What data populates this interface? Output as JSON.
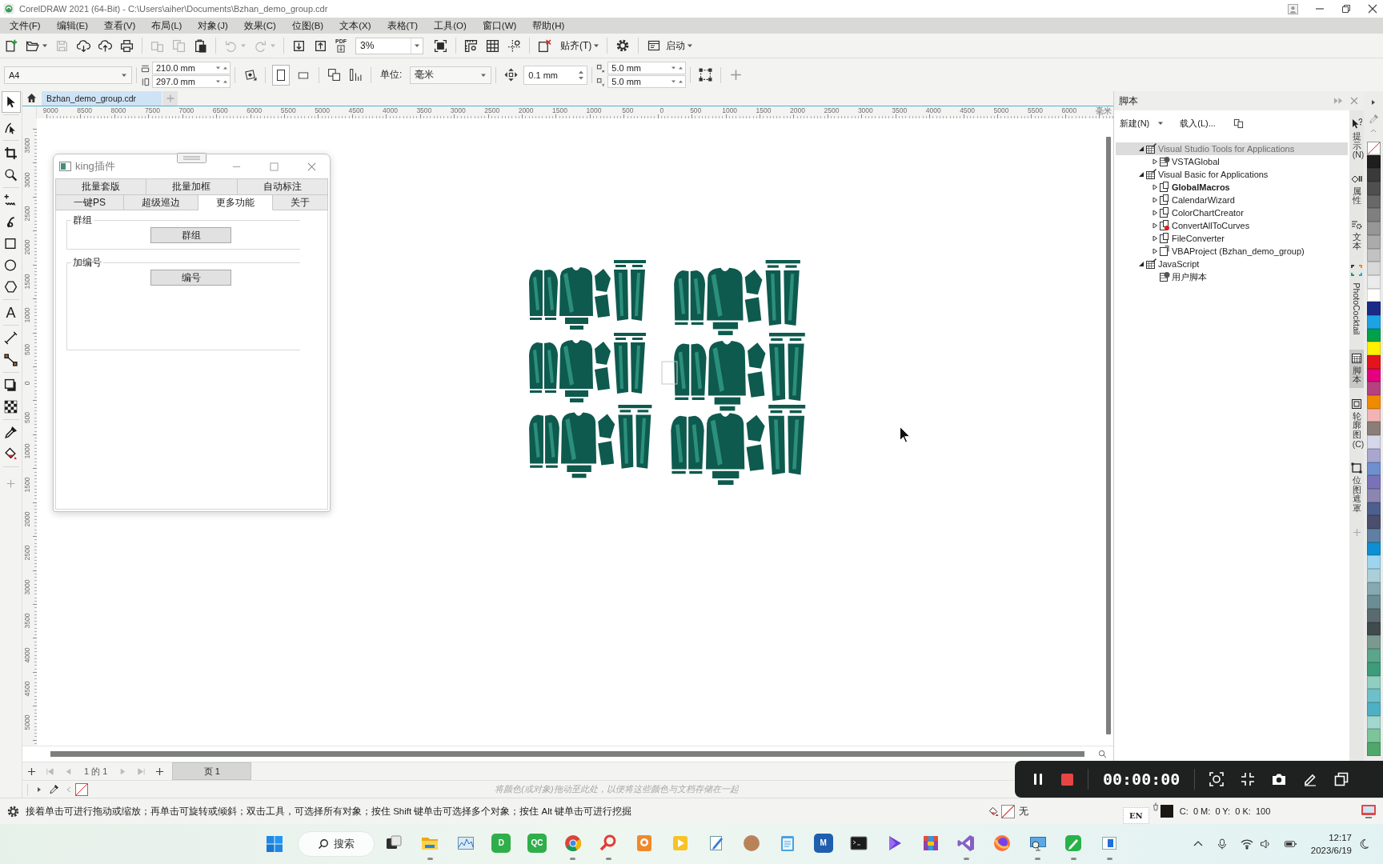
{
  "window": {
    "title": "CorelDRAW 2021 (64-Bit) - C:\\Users\\aiher\\Documents\\Bzhan_demo_group.cdr"
  },
  "menu": [
    "文件(F)",
    "编辑(E)",
    "查看(V)",
    "布局(L)",
    "对象(J)",
    "效果(C)",
    "位图(B)",
    "文本(X)",
    "表格(T)",
    "工具(O)",
    "窗口(W)",
    "帮助(H)"
  ],
  "toolbar": {
    "left_groups": [
      [
        {
          "kind": "new",
          "disabled": false
        },
        {
          "kind": "open",
          "disabled": false
        },
        {
          "kind": "save",
          "disabled": true
        },
        {
          "kind": "cloud-download",
          "disabled": false
        },
        {
          "kind": "cloud-upload",
          "disabled": false
        },
        {
          "kind": "print",
          "disabled": false
        }
      ],
      [
        {
          "kind": "cut",
          "disabled": true
        },
        {
          "kind": "copy",
          "disabled": true
        },
        {
          "kind": "paste",
          "disabled": false
        }
      ],
      [
        {
          "kind": "undo",
          "disabled": true
        },
        {
          "kind": "redo",
          "disabled": true
        }
      ],
      [
        {
          "kind": "import",
          "disabled": false
        },
        {
          "kind": "export",
          "disabled": false
        },
        {
          "kind": "pdf",
          "disabled": false,
          "label": "PDF"
        }
      ]
    ],
    "zoom": "3%",
    "right_groups": [
      [
        {
          "kind": "full-page",
          "disabled": false
        }
      ],
      [
        {
          "kind": "rulers",
          "disabled": false
        },
        {
          "kind": "grid",
          "disabled": false
        },
        {
          "kind": "guides",
          "disabled": false
        }
      ],
      [
        {
          "kind": "snap-off",
          "disabled": false
        }
      ]
    ],
    "snap_label": "贴齐(T)",
    "launch_label": "启动"
  },
  "property_bar": {
    "page_size": "A4",
    "page_width": "210.0 mm",
    "page_height": "297.0 mm",
    "orientations": [
      {
        "kind": "portrait",
        "selected": true
      },
      {
        "kind": "landscape",
        "selected": false
      }
    ],
    "units_label": "单位:",
    "units": "毫米",
    "nudge": "0.1 mm",
    "duplicate_x": "5.0 mm",
    "duplicate_y": "5.0 mm"
  },
  "document_tabs": [
    {
      "label": "Bzhan_demo_group.cdr",
      "selected": true
    }
  ],
  "toolbox": [
    [
      {
        "kind": "pick",
        "selected": true
      }
    ],
    [
      {
        "kind": "shape",
        "selected": false
      }
    ],
    [
      {
        "kind": "crop",
        "selected": false
      },
      {
        "kind": "zoom",
        "selected": false
      }
    ],
    [
      {
        "kind": "freehand",
        "selected": false
      },
      {
        "kind": "artistic-media",
        "selected": false
      },
      {
        "kind": "rectangle",
        "selected": false
      },
      {
        "kind": "ellipse",
        "selected": false
      },
      {
        "kind": "polygon",
        "selected": false
      }
    ],
    [
      {
        "kind": "text",
        "selected": false,
        "label": "A"
      }
    ],
    [
      {
        "kind": "dimension",
        "selected": false
      },
      {
        "kind": "connector",
        "selected": false
      }
    ],
    [
      {
        "kind": "shadow",
        "selected": false
      },
      {
        "kind": "transparency",
        "selected": false
      }
    ],
    [
      {
        "kind": "eyedropper",
        "selected": false
      },
      {
        "kind": "fill",
        "selected": false
      }
    ]
  ],
  "rulers": {
    "horizontal": [
      "9000",
      "8500",
      "8000",
      "7500",
      "7000",
      "6500",
      "6000",
      "5500",
      "5000",
      "4500",
      "4000",
      "3500",
      "3000",
      "2500",
      "2000",
      "1500",
      "1000",
      "500",
      "0",
      "500",
      "1000",
      "1500",
      "2000",
      "2500",
      "3000",
      "3500",
      "4000",
      "4500",
      "5000",
      "5500",
      "6000"
    ],
    "unit": "毫米",
    "vertical": [
      "3500",
      "3000",
      "2500",
      "2000",
      "1500",
      "1000",
      "500",
      "0",
      "500",
      "1000",
      "1500",
      "2000",
      "2500",
      "3000",
      "3500",
      "4000",
      "4500",
      "5000"
    ]
  },
  "plugin_dialog": {
    "title": "king插件",
    "tab_rows": [
      [
        {
          "label": "批量套版",
          "selected": false
        },
        {
          "label": "批量加框",
          "selected": false
        },
        {
          "label": "自动标注",
          "selected": false
        }
      ],
      [
        {
          "label": "一键PS",
          "selected": false
        },
        {
          "label": "超级巡边",
          "selected": false
        },
        {
          "label": "更多功能",
          "selected": true
        },
        {
          "label": "关于",
          "selected": false
        }
      ]
    ],
    "groups": [
      {
        "title": "群组",
        "button": "群组"
      },
      {
        "title": "加编号",
        "button": "编号"
      }
    ]
  },
  "docker": {
    "title": "脚本",
    "new_label": "新建(N)",
    "load_label": "载入(L)...",
    "tree": [
      {
        "label": "Visual Studio Tools for Applications",
        "kind": "root",
        "expanded": true,
        "selected": true,
        "disabled": true,
        "active": false,
        "children": [
          {
            "label": "VSTAGlobal",
            "kind": "global",
            "expanded": false,
            "selected": false,
            "disabled": false,
            "active": false
          }
        ]
      },
      {
        "label": "Visual Basic for Applications",
        "kind": "root",
        "expanded": true,
        "selected": false,
        "disabled": false,
        "active": false,
        "children": [
          {
            "label": "GlobalMacros",
            "kind": "project",
            "expanded": false,
            "selected": false,
            "disabled": false,
            "active": true
          },
          {
            "label": "CalendarWizard",
            "kind": "project",
            "expanded": false,
            "selected": false,
            "disabled": false,
            "active": false
          },
          {
            "label": "ColorChartCreator",
            "kind": "project",
            "expanded": false,
            "selected": false,
            "disabled": false,
            "active": false
          },
          {
            "label": "ConvertAllToCurves",
            "kind": "project-error",
            "expanded": false,
            "selected": false,
            "disabled": false,
            "active": false
          },
          {
            "label": "FileConverter",
            "kind": "project",
            "expanded": false,
            "selected": false,
            "disabled": false,
            "active": false
          },
          {
            "label": "VBAProject (Bzhan_demo_group)",
            "kind": "document",
            "expanded": false,
            "selected": false,
            "disabled": false,
            "active": false
          }
        ]
      },
      {
        "label": "JavaScript",
        "kind": "root",
        "expanded": true,
        "selected": false,
        "disabled": false,
        "active": false,
        "children": [
          {
            "label": "用户脚本",
            "kind": "global",
            "selected": false,
            "disabled": false,
            "active": false
          }
        ]
      }
    ]
  },
  "docker_tabs": [
    {
      "kind": "hints",
      "label": "提示(N)",
      "selected": false
    },
    {
      "kind": "properties",
      "label": "属性",
      "selected": false
    },
    {
      "kind": "text",
      "label": "文本",
      "selected": false
    },
    {
      "kind": "photococktail",
      "label": "PhotoCocktail",
      "selected": false
    },
    {
      "kind": "scripts",
      "label": "脚本",
      "selected": true
    },
    {
      "kind": "contour",
      "label": "轮廓图(C)",
      "selected": false
    },
    {
      "kind": "bitmap-mask",
      "label": "位图遮罩",
      "selected": false
    }
  ],
  "palette": [
    {
      "color": "#1e1e1e"
    },
    {
      "color": "#3a3a3a"
    },
    {
      "color": "#4f4f4f"
    },
    {
      "color": "#686868"
    },
    {
      "color": "#7f7f7f"
    },
    {
      "color": "#969696"
    },
    {
      "color": "#ababab"
    },
    {
      "color": "#c2c2c2"
    },
    {
      "color": "#d8d8d8"
    },
    {
      "color": "#ebebeb"
    },
    {
      "color": "#ffffff"
    },
    {
      "color": "#1b2a87"
    },
    {
      "color": "#1ba3e3"
    },
    {
      "color": "#00a14b"
    },
    {
      "color": "#fff200"
    },
    {
      "color": "#e3141b"
    },
    {
      "color": "#e4007f"
    },
    {
      "color": "#b5417f"
    },
    {
      "color": "#f08a00"
    },
    {
      "color": "#f2b3b3"
    },
    {
      "color": "#8b7d77"
    },
    {
      "color": "#d6d6ea"
    },
    {
      "color": "#a9a6d0"
    },
    {
      "color": "#6f8fcf"
    },
    {
      "color": "#7a72b8"
    },
    {
      "color": "#8b85b0"
    },
    {
      "color": "#4d5f8e"
    },
    {
      "color": "#4b4e6c"
    },
    {
      "color": "#5f7fa3"
    },
    {
      "color": "#0d8fd3"
    },
    {
      "color": "#9dd5ee"
    },
    {
      "color": "#a9cfd8"
    },
    {
      "color": "#86a9b1"
    },
    {
      "color": "#6b8d94"
    },
    {
      "color": "#5a6a6e"
    },
    {
      "color": "#3f4b4d"
    },
    {
      "color": "#7a9a90"
    },
    {
      "color": "#5aa58c"
    },
    {
      "color": "#3d9b7a"
    },
    {
      "color": "#8fcfc0"
    },
    {
      "color": "#6ec0c8"
    },
    {
      "color": "#4fb0c4"
    },
    {
      "color": "#a0d8cf"
    },
    {
      "color": "#7cc49a"
    },
    {
      "color": "#4ea86a"
    }
  ],
  "page_navigator": {
    "position": "1 的 1",
    "pages": [
      {
        "label": "页 1",
        "selected": true
      }
    ]
  },
  "document_palette": {
    "hint": "将颜色(或对象)拖动至此处，以便将这些颜色与文档存储在一起"
  },
  "status_bar": {
    "message": "接着单击可进行拖动或缩放；再单击可旋转或倾斜；双击工具，可选择所有对象；按住 Shift 键单击可选择多个对象；按住 Alt 键单击可进行挖掘",
    "fill_label": "无",
    "ime": "EN",
    "outline_values": "C:  0 M:  0 Y:  0 K:  100"
  },
  "recorder": {
    "elapsed": "00:00:00"
  },
  "taskbar": {
    "search": {
      "placeholder": "搜索"
    },
    "apps": [
      {
        "kind": "task-view",
        "running": false
      },
      {
        "kind": "explorer",
        "running": true
      },
      {
        "kind": "res-monitor",
        "running": false
      },
      {
        "kind": "tile",
        "label": "D",
        "running": false
      },
      {
        "kind": "tile",
        "label": "QC",
        "running": false
      },
      {
        "kind": "chrome",
        "running": true
      },
      {
        "kind": "search-app",
        "running": true
      },
      {
        "kind": "pdf-app",
        "running": false
      },
      {
        "kind": "video-app",
        "running": false
      },
      {
        "kind": "pen-note",
        "running": false
      },
      {
        "kind": "avatar",
        "running": false
      },
      {
        "kind": "notepad",
        "running": false
      },
      {
        "kind": "tile-blue",
        "label": "M",
        "running": false
      },
      {
        "kind": "terminal",
        "running": false
      },
      {
        "kind": "purple-play",
        "running": false
      },
      {
        "kind": "archive",
        "running": false
      },
      {
        "kind": "vs",
        "running": true
      },
      {
        "kind": "firefox",
        "running": false
      },
      {
        "kind": "monitor-search",
        "running": true
      },
      {
        "kind": "green-pen",
        "running": true
      },
      {
        "kind": "window-app",
        "running": true
      }
    ],
    "clock": {
      "time": "12:17",
      "date": "2023/6/19"
    }
  }
}
